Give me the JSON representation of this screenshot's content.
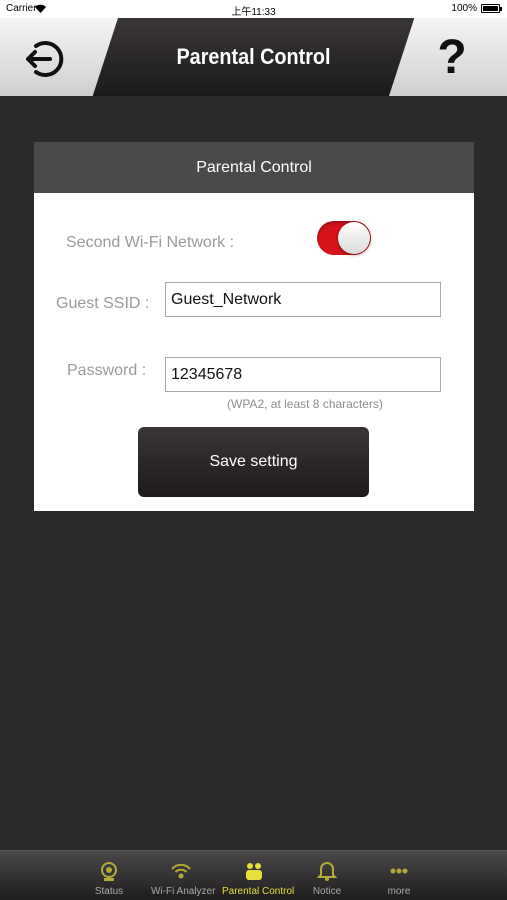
{
  "status_bar": {
    "carrier": "Carrier",
    "time": "上午11:33",
    "battery": "100%"
  },
  "header": {
    "title": "Parental Control",
    "help_label": "?"
  },
  "card": {
    "title": "Parental Control",
    "second_wifi_label": "Second Wi-Fi Network :",
    "second_wifi_enabled": true,
    "guest_ssid_label": "Guest SSID :",
    "guest_ssid_value": "Guest_Network",
    "password_label": "Password :",
    "password_value": "12345678",
    "password_hint": "(WPA2, at least 8 characters)",
    "save_label": "Save setting"
  },
  "colors": {
    "toggle_on": "#d5141b",
    "active_tab": "#e7df3a",
    "background": "#2b2a2a"
  },
  "tab_bar": {
    "items": [
      {
        "label": "Status",
        "icon": "status-icon",
        "active": false
      },
      {
        "label": "Wi-Fi Analyzer",
        "icon": "wifi-analyzer-icon",
        "active": false
      },
      {
        "label": "Parental Control",
        "icon": "parental-control-icon",
        "active": true
      },
      {
        "label": "Notice",
        "icon": "notice-icon",
        "active": false
      },
      {
        "label": "more",
        "icon": "more-icon",
        "active": false
      }
    ]
  }
}
